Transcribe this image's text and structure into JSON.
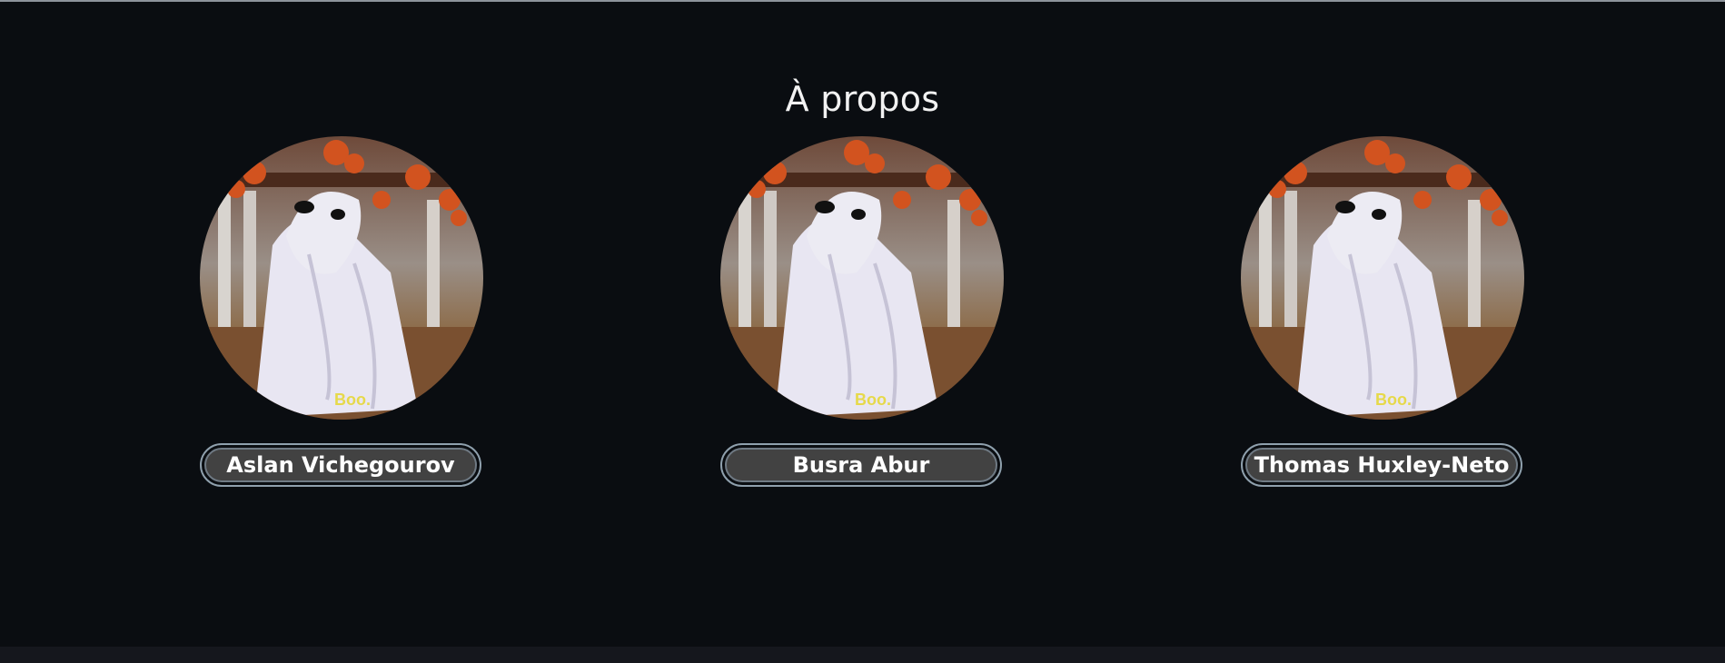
{
  "page": {
    "title": "À propos"
  },
  "members": [
    {
      "name": "Aslan Vichegourov",
      "caption": "Boo."
    },
    {
      "name": "Busra Abur",
      "caption": "Boo."
    },
    {
      "name": "Thomas Huxley-Neto",
      "caption": "Boo."
    }
  ]
}
